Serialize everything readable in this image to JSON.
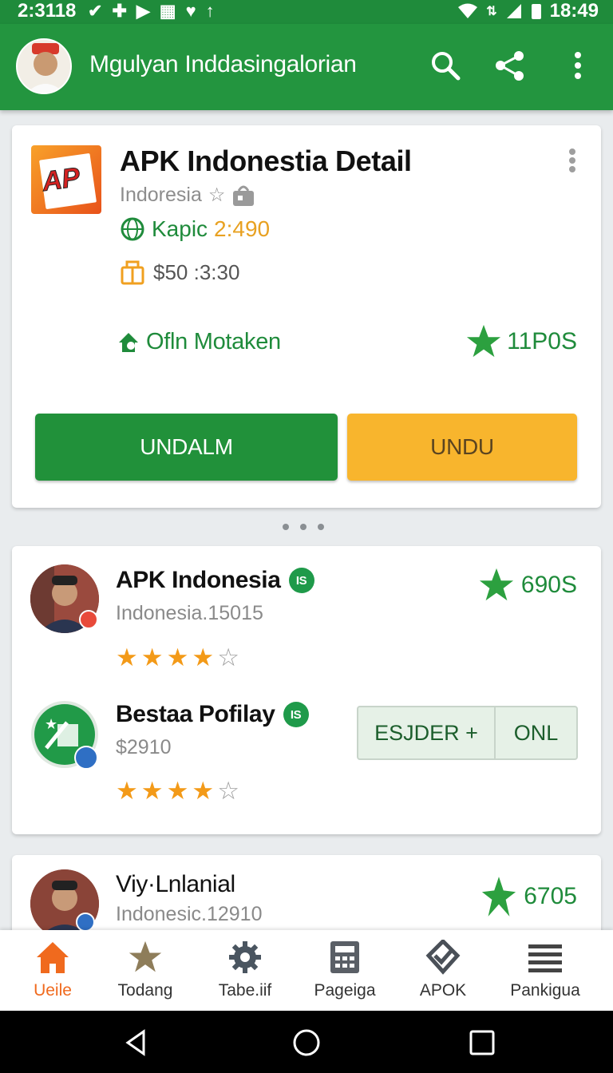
{
  "status_bar": {
    "time_left": "2:3118",
    "time_right": "18:49"
  },
  "app_bar": {
    "title": "Mgulyan Inddasingalorian",
    "icons": [
      "search-icon",
      "share-icon",
      "more-vert-icon"
    ]
  },
  "detail_card": {
    "title": "APK Indonestia Detail",
    "logo_text": "AP",
    "subtitle": "Indoresia",
    "kapic_label": "Kapic",
    "kapic_value": "2:490",
    "price": "$50 :3:30",
    "ownload_label": "Ofln Motaken",
    "rating": "11P0S",
    "primary_button": "UNDALM",
    "secondary_button": "UNDU",
    "colors": {
      "primary": "#21913a",
      "secondary": "#f8b52d"
    }
  },
  "list": [
    {
      "title": "APK Indonesia",
      "badge": "IS",
      "subtitle": "Indonesia.15015",
      "stars": 4,
      "rating": "690S"
    },
    {
      "title": "Bestaa Pofilay",
      "badge": "IS",
      "subtitle": "$2910",
      "stars": 4,
      "button_left": "ESJDER +",
      "button_right": "ONL"
    },
    {
      "title": "Viy·Lnlanial",
      "subtitle": "Indonesic.12910",
      "rating": "6705"
    }
  ],
  "bottom_nav": [
    {
      "label": "Ueile",
      "icon": "home-icon",
      "active": true
    },
    {
      "label": "Todang",
      "icon": "star-icon",
      "active": false
    },
    {
      "label": "Tabe.iif",
      "icon": "gear-icon",
      "active": false
    },
    {
      "label": "Pageiga",
      "icon": "calculator-icon",
      "active": false
    },
    {
      "label": "APOK",
      "icon": "check-badge-icon",
      "active": false
    },
    {
      "label": "Pankigua",
      "icon": "menu-icon",
      "active": false
    }
  ]
}
